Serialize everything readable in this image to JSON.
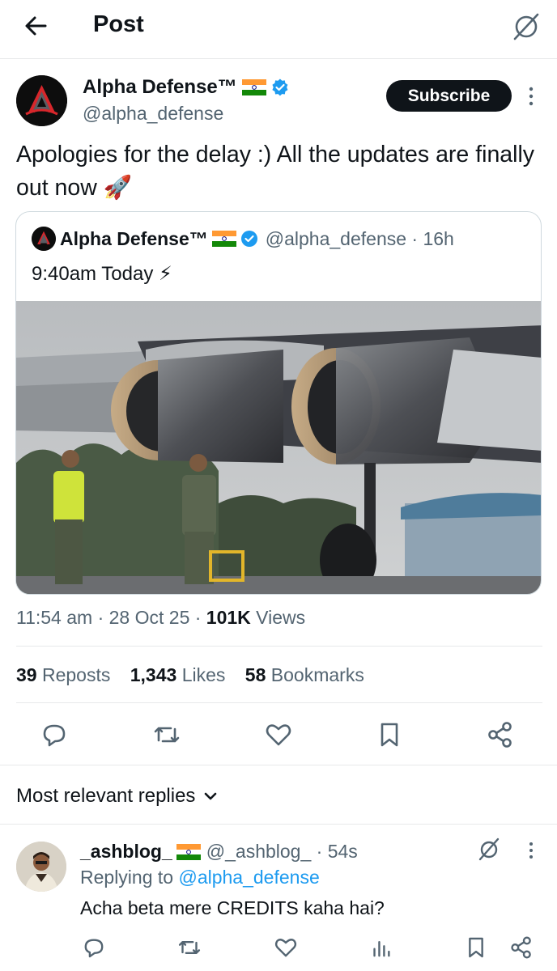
{
  "header": {
    "title": "Post"
  },
  "post": {
    "author_name": "Alpha Defense™",
    "handle": "@alpha_defense",
    "subscribe_label": "Subscribe",
    "text": "Apologies for the delay :) All the updates are finally out now 🚀",
    "quote": {
      "author_name": "Alpha Defense™",
      "handle": "@alpha_defense · 16h",
      "text": "9:40am Today ⚡"
    },
    "meta": {
      "time": "11:54 am · 28 Oct 25 · ",
      "views_count": "101K",
      "views_label": " Views"
    },
    "stats": [
      {
        "count": "39",
        "label": " Reposts"
      },
      {
        "count": "1,343",
        "label": " Likes"
      },
      {
        "count": "58",
        "label": " Bookmarks"
      }
    ],
    "actions": [
      "reply-icon",
      "repost-icon",
      "like-icon",
      "bookmark-icon",
      "share-icon"
    ]
  },
  "replies": {
    "sort_label": "Most relevant replies",
    "items": [
      {
        "author_name": "_ashblog_",
        "handle": "@_ashblog_ · 54s",
        "replying_prefix": "Replying to ",
        "replying_to": "@alpha_defense",
        "text": "Acha beta mere CREDITS kaha hai?"
      }
    ]
  },
  "colors": {
    "accent": "#1d9bf0",
    "text": "#0f1419",
    "muted": "#536471",
    "border": "#cfd9de"
  }
}
